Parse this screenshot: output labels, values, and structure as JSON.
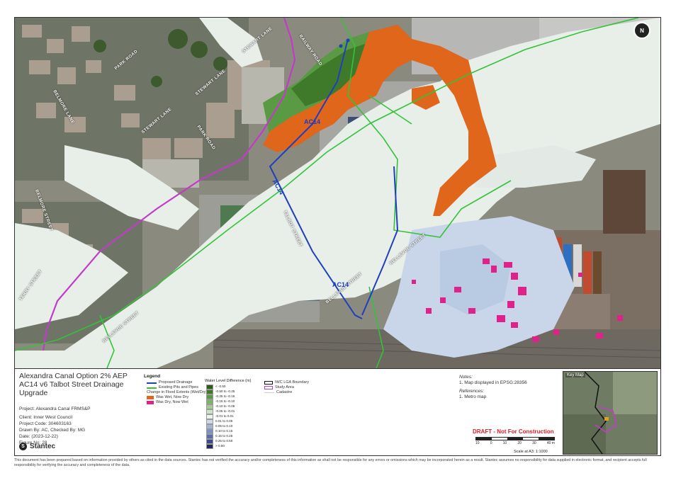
{
  "title_block": {
    "title_line1": "Alexandra Canal Option 2% AEP",
    "title_line2": "AC14 v6 Talbot Street Drainage",
    "title_line3": "Upgrade",
    "project": "Project: Alexandra Canal FRMS&P",
    "client": "Client: Inner West Council",
    "project_code": "Project Code: 304603163",
    "drawn_by": "Drawn By: AC, Checked By: MG",
    "date": "Date: (2023-12-22)",
    "figure_no": "Figure No: 28",
    "company": "Stantec"
  },
  "legend": {
    "title": "Legend",
    "proposed_drainage": "Proposed Drainage",
    "existing_pits_pipes": "Existing Pits and Pipes",
    "flood_extents_heading": "Change in Flood Extents (Wet/Dry)",
    "was_wet_now_dry": "Was Wet, Now Dry",
    "was_dry_now_wet": "Was Dry, Now Wet",
    "water_level_title": "Water Level Difference (m)",
    "water_level_classes": [
      {
        "label": "< -0.50",
        "color": "#2f5b1f"
      },
      {
        "label": "-0.50 to -0.25",
        "color": "#3f7a2a"
      },
      {
        "label": "-0.25 to -0.15",
        "color": "#5a9a44"
      },
      {
        "label": "-0.15 to -0.10",
        "color": "#7fb56a"
      },
      {
        "label": "-0.10 to -0.05",
        "color": "#a6cc94"
      },
      {
        "label": "-0.05 to -0.01",
        "color": "#cfe3c4"
      },
      {
        "label": "-0.01 to 0.01",
        "color": "#eef4ee"
      },
      {
        "label": "0.01 to 0.05",
        "color": "#cdd8ea"
      },
      {
        "label": "0.05 to 0.10",
        "color": "#a4b6d6"
      },
      {
        "label": "0.10 to 0.15",
        "color": "#7c91c1"
      },
      {
        "label": "0.15 to 0.25",
        "color": "#5b6ca8"
      },
      {
        "label": "0.25 to 0.50",
        "color": "#3d4a8a"
      },
      {
        "label": "> 0.50",
        "color": "#24285c"
      }
    ],
    "lga_boundary": "IWC LGA Boundary",
    "study_area": "Study Area",
    "cadastre": "Cadastre"
  },
  "colors": {
    "was_wet_now_dry": "#e0661c",
    "was_dry_now_wet": "#e0218a",
    "proposed_drainage": "#1f3fbf",
    "existing_pits": "#35c23a",
    "lga_boundary": "#c23cc8",
    "study_area": "#c23cc8"
  },
  "notes": {
    "heading": "Notes:",
    "note1": "1. Map displayed in EPSG:28356",
    "ref_heading": "References:",
    "ref1": "1. Metro map"
  },
  "draft": "DRAFT - Not For Construction",
  "scale": {
    "ticks": [
      "10",
      "0",
      "10",
      "20",
      "30",
      "40 m"
    ],
    "text": "Scale at A3: 1:1000"
  },
  "key_map_title": "Key Map",
  "map_labels": {
    "stewart_lane_1": "STEWART LANE",
    "railway_road": "RAILWAY ROAD",
    "park_road_1": "PARK ROAD",
    "belmore_lane": "BELMORE LANE",
    "stewart_lane_2": "STEWART LANE",
    "park_road_2": "PARK ROAD",
    "stewart_lane_3": "STEWART LANE",
    "belmore_street": "BELMORE STREET",
    "talbot_street": "TALBOT STREET",
    "bellevue_street_1": "BELLEVUE STREET",
    "bellevue_street_2": "BELLEVUE STREET",
    "terry_street": "TERRY STREET",
    "bellevue_street_3": "BELLEVUE STREET",
    "ac14_a": "AC14",
    "ac14_b": "AC14",
    "ac14_c": "AC14",
    "north": "N"
  },
  "disclaimer": "This document has been prepared based on information provided by others as cited in the data sources. Stantec has not verified the accuracy and/or completeness of this information as shall not be responsible for any errors or omissions which may be incorporated herein as a result. Stantec assumes no responsibility for data supplied in electronic format, and recipient accepts full responsibility for verifying the accuracy and completeness of the data."
}
